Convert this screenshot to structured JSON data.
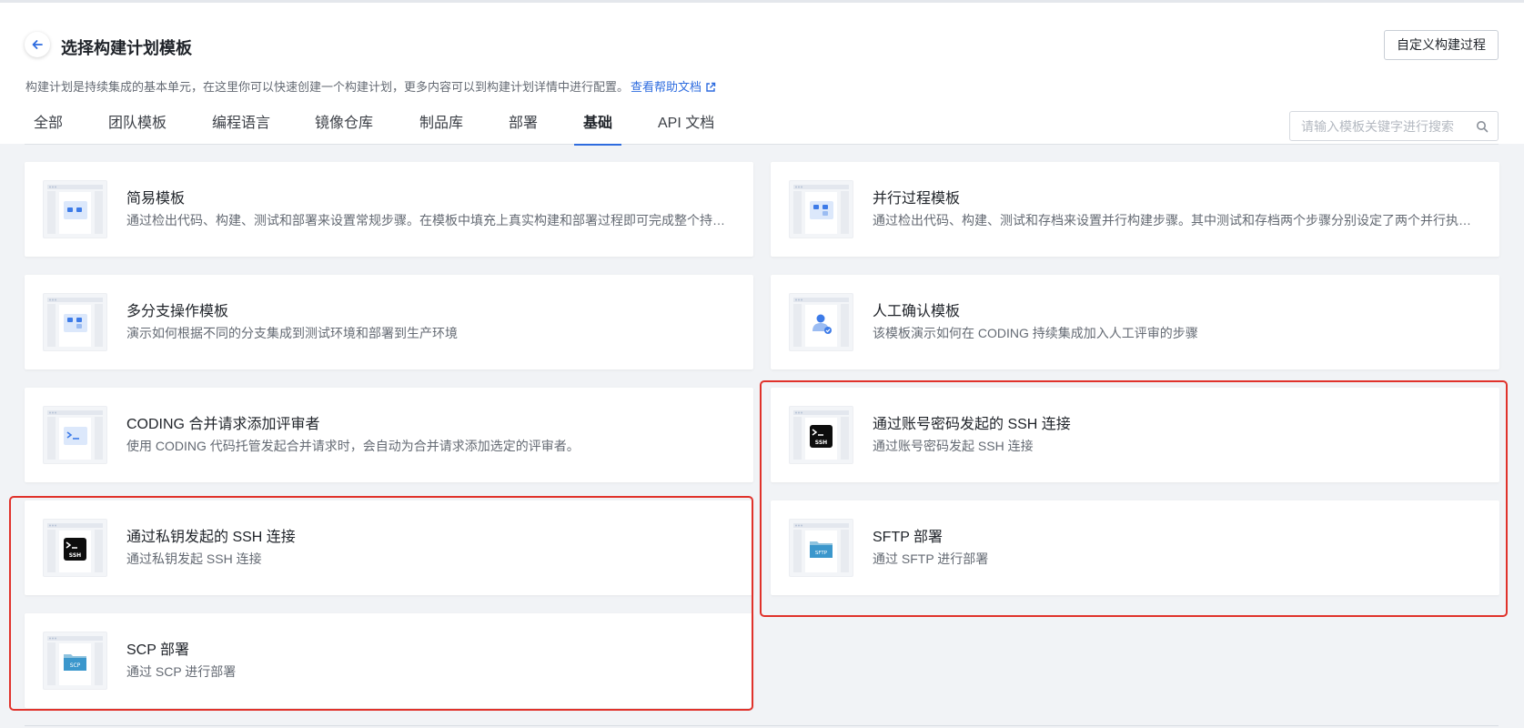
{
  "header": {
    "title": "选择构建计划模板",
    "custom_button": "自定义构建过程",
    "description": "构建计划是持续集成的基本单元，在这里你可以快速创建一个构建计划，更多内容可以到构建计划详情中进行配置。",
    "help_link": "查看帮助文档"
  },
  "tabs": [
    {
      "label": "全部"
    },
    {
      "label": "团队模板"
    },
    {
      "label": "编程语言"
    },
    {
      "label": "镜像仓库"
    },
    {
      "label": "制品库"
    },
    {
      "label": "部署"
    },
    {
      "label": "基础",
      "active": true
    },
    {
      "label": "API 文档"
    }
  ],
  "search": {
    "placeholder": "请输入模板关键字进行搜索"
  },
  "templates": [
    {
      "title": "简易模板",
      "desc": "通过检出代码、构建、测试和部署来设置常规步骤。在模板中填充上真实构建和部署过程即可完成整个持续集成。",
      "icon": "flow-diagram-icon"
    },
    {
      "title": "并行过程模板",
      "desc": "通过检出代码、构建、测试和存档来设置并行构建步骤。其中测试和存档两个步骤分别设定了两个并行执行的阶段。",
      "icon": "parallel-flow-icon"
    },
    {
      "title": "多分支操作模板",
      "desc": "演示如何根据不同的分支集成到测试环境和部署到生产环境",
      "icon": "branch-flow-icon"
    },
    {
      "title": "人工确认模板",
      "desc": "该模板演示如何在 CODING 持续集成加入人工评审的步骤",
      "icon": "user-check-icon"
    },
    {
      "title": "CODING 合并请求添加评审者",
      "desc": "使用 CODING 代码托管发起合并请求时，会自动为合并请求添加选定的评审者。",
      "icon": "terminal-icon"
    },
    {
      "title": "通过账号密码发起的 SSH 连接",
      "desc": "通过账号密码发起 SSH 连接",
      "icon": "ssh-icon",
      "icon_text": "SSH"
    },
    {
      "title": "通过私钥发起的 SSH 连接",
      "desc": "通过私钥发起 SSH 连接",
      "icon": "ssh-icon",
      "icon_text": "SSH"
    },
    {
      "title": "SFTP 部署",
      "desc": "通过 SFTP 进行部署",
      "icon": "sftp-folder-icon",
      "icon_text": "SFTP"
    },
    {
      "title": "SCP 部署",
      "desc": "通过 SCP 进行部署",
      "icon": "scp-folder-icon",
      "icon_text": "SCP"
    }
  ],
  "colors": {
    "accent": "#2e6cdf",
    "highlight": "#e0322b",
    "background": "#f1f3f6"
  }
}
